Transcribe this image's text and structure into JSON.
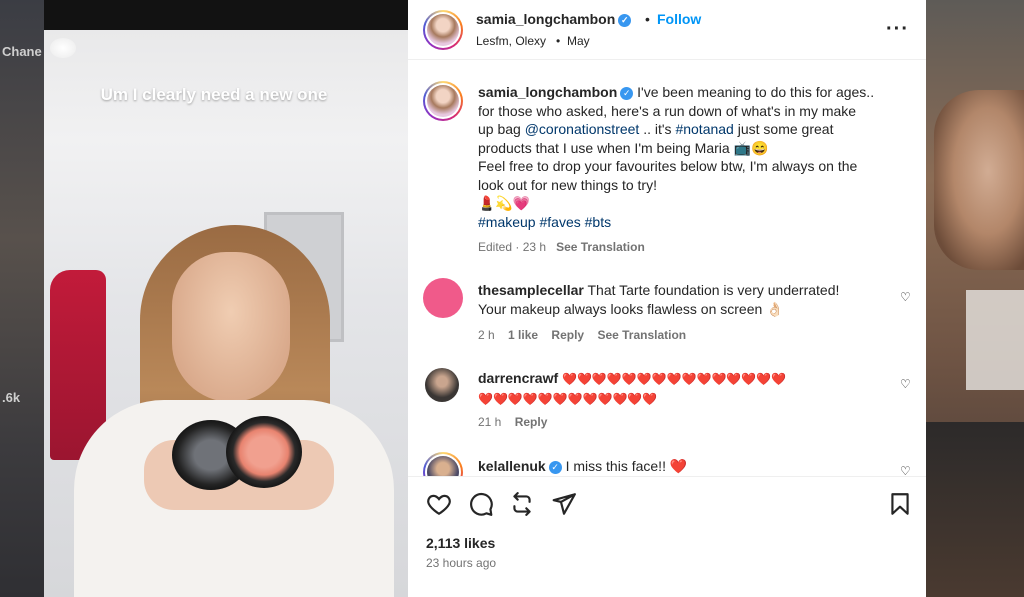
{
  "background": {
    "left_labels": [
      "Chane",
      ".6k"
    ]
  },
  "video": {
    "caption": "Um I clearly need a new one"
  },
  "header": {
    "username": "samia_longchambon",
    "follow_label": "Follow",
    "audio": "Lesfm, Olexy",
    "date": "May",
    "separator": "•"
  },
  "post": {
    "username": "samia_longchambon",
    "caption_lines": [
      "I've been meaning to do this for ages..",
      "for those who asked, here's a run down of what's in my make",
      "up bag",
      "@coronationstreet",
      ".. it's",
      "#notanad",
      "just some great",
      "products that I use when I'm being Maria 📺😄",
      "Feel free to drop your favourites below btw, I'm always on the",
      "look out for new things to try!",
      "💄💫💗",
      "#makeup #faves #bts"
    ],
    "meta": {
      "edited": "Edited",
      "time": "23 h",
      "see_translation": "See Translation"
    }
  },
  "comments": [
    {
      "username": "thesamplecellar",
      "text_line1": "That Tarte foundation is very underrated!",
      "text_line2": "Your makeup always looks flawless on screen 👌🏻",
      "time": "2 h",
      "likes": "1 like",
      "reply": "Reply",
      "see_translation": "See Translation"
    },
    {
      "username": "darrencrawf",
      "text_line1": "❤️❤️❤️❤️❤️❤️❤️❤️❤️❤️❤️❤️❤️❤️❤️",
      "text_line2": "❤️❤️❤️❤️❤️❤️❤️❤️❤️❤️❤️❤️",
      "time": "21 h",
      "reply": "Reply"
    },
    {
      "username": "kelallenuk",
      "text_line1": "I miss this face!! ❤️"
    }
  ],
  "footer": {
    "likes": "2,113 likes",
    "time_ago": "23 hours ago"
  }
}
